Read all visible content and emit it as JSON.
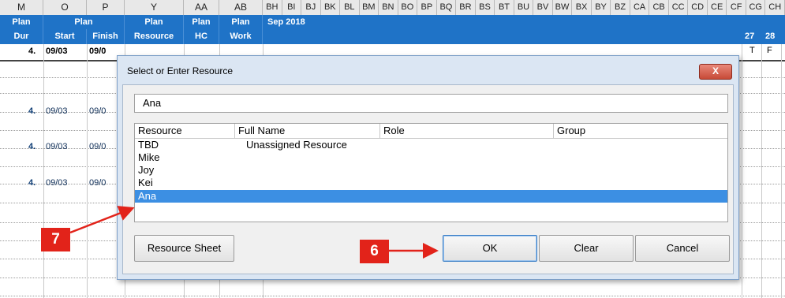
{
  "sheet": {
    "column_headers": [
      "M",
      "O",
      "P",
      "Y",
      "AA",
      "AB"
    ],
    "gantt_column_headers": [
      "BH",
      "BI",
      "BJ",
      "BK",
      "BL",
      "BM",
      "BN",
      "BO",
      "BP",
      "BQ",
      "BR",
      "BS",
      "BT",
      "BU",
      "BV",
      "BW",
      "BX",
      "BY",
      "BZ",
      "CA",
      "CB",
      "CC",
      "CD",
      "CE",
      "CF",
      "CG",
      "CH"
    ],
    "plan_row": [
      "Plan",
      "Plan",
      "Plan",
      "Plan",
      "Plan"
    ],
    "sub_row": [
      "Dur",
      "Start",
      "Finish",
      "Resource",
      "HC",
      "Work"
    ],
    "month_label": "Sep 2018",
    "day_numbers": [
      "27",
      "28"
    ],
    "day_letters": [
      "T",
      "F"
    ],
    "first_row": {
      "dur": "4.",
      "start": "09/03",
      "finish": "09/0"
    },
    "task_rows": [
      {
        "dur": "4.",
        "start": "09/03",
        "finish": "09/0"
      },
      {
        "dur": "4.",
        "start": "09/03",
        "finish": "09/0"
      },
      {
        "dur": "4.",
        "start": "09/03",
        "finish": "09/0"
      }
    ]
  },
  "dialog": {
    "title": "Select or Enter Resource",
    "close_label": "X",
    "entry_value": "Ana",
    "columns": [
      "Resource",
      "Full Name",
      "Role",
      "Group"
    ],
    "rows": [
      {
        "resource": "TBD",
        "full_name": "Unassigned Resource",
        "role": "",
        "group": ""
      },
      {
        "resource": "Mike",
        "full_name": "",
        "role": "",
        "group": ""
      },
      {
        "resource": "Joy",
        "full_name": "",
        "role": "",
        "group": ""
      },
      {
        "resource": "Kei",
        "full_name": "",
        "role": "",
        "group": ""
      },
      {
        "resource": "Ana",
        "full_name": "",
        "role": "",
        "group": "",
        "selected": true
      }
    ],
    "buttons": {
      "resource_sheet": "Resource Sheet",
      "ok": "OK",
      "clear": "Clear",
      "cancel": "Cancel"
    }
  },
  "annotations": {
    "step_7": "7",
    "step_6": "6",
    "color": "#e2231a"
  }
}
